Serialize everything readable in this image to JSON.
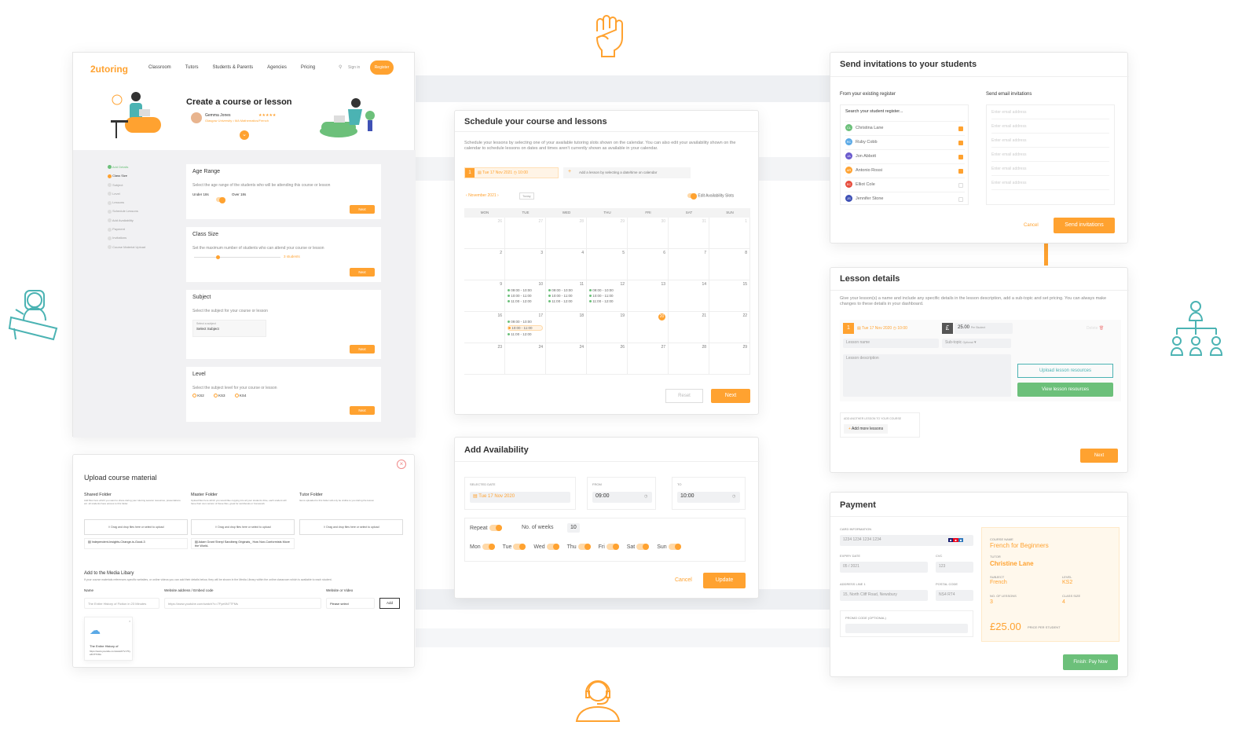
{
  "colors": {
    "accent": "#ffa230",
    "green": "#6cc07a",
    "teal": "#4bb3b3"
  },
  "brand": {
    "logo": "2utoring"
  },
  "nav": {
    "items": [
      "Classroom",
      "Tutors",
      "Students & Parents",
      "Agencies",
      "Pricing"
    ],
    "signin": "Sign in",
    "register": "Register"
  },
  "create": {
    "title": "Create a course or lesson",
    "tutor_name": "Gemma Jones",
    "tutor_sub": "Glasgow University • MA Mathematics/French",
    "steps": [
      "Add Details",
      "Class Size",
      "Subject",
      "Level",
      "Lessons",
      "Schedule Lessons",
      "Add Availability",
      "Payment",
      "Invitations",
      "Course Material Upload"
    ],
    "age": {
      "title": "Age Range",
      "desc": "Select the age range of the students who will be attending this course or lesson",
      "opt1": "Under 18s",
      "opt2": "Over 18s",
      "next": "Next"
    },
    "class": {
      "title": "Class Size",
      "desc": "Set the maximum number of students who can attend your course or lesson",
      "value": "3 students",
      "next": "Next"
    },
    "subject": {
      "title": "Subject",
      "desc": "Select the subject for your course or lesson",
      "select_label": "Select a subject",
      "select_value": "Select Subject",
      "next": "Next"
    },
    "level": {
      "title": "Level",
      "desc": "Select the subject level for your course or lesson",
      "opts": [
        "KS2",
        "KS3",
        "KS4"
      ],
      "next": "Next"
    }
  },
  "schedule": {
    "title": "Schedule your course and lessons",
    "desc": "Schedule your lessons by selecting one of your available tutoring slots shown on the calendar. You can also edit your availability shown on the calendar to schedule lessons on dates and times aren't currently shown as available in your calendar.",
    "lesson_num": "1",
    "lesson_date": "Tue 17 Nov 2021",
    "lesson_time": "10:00",
    "add_hint": "Add a lesson by selecting a date/time on calendar",
    "month": "November 2021",
    "today": "Today",
    "edit_avail": "Edit Availability Slots",
    "days": [
      "MON",
      "TUE",
      "WED",
      "THU",
      "FRI",
      "SAT",
      "SUN"
    ],
    "weeks": [
      [
        "26",
        "27",
        "28",
        "29",
        "30",
        "31",
        "1"
      ],
      [
        "2",
        "3",
        "4",
        "5",
        "6",
        "7",
        "8"
      ],
      [
        "9",
        "10",
        "11",
        "12",
        "13",
        "14",
        "15"
      ],
      [
        "16",
        "17",
        "18",
        "19",
        "20",
        "21",
        "22"
      ],
      [
        "23",
        "24",
        "24",
        "26",
        "27",
        "28",
        "29"
      ]
    ],
    "slots": [
      "09:00 - 10:00",
      "10:00 - 11:00",
      "11:00 - 12:00"
    ],
    "reset": "Reset",
    "next": "Next"
  },
  "availability": {
    "title": "Add Availability",
    "date_label": "SELECTED DATE",
    "date": "Tue 17 Nov 2020",
    "from_label": "FROM",
    "from": "09:00",
    "to_label": "TO",
    "to": "10:00",
    "repeat": "Repeat",
    "weeks_label": "No. of weeks",
    "weeks": "10",
    "days": [
      "Mon",
      "Tue",
      "Wed",
      "Thu",
      "Fri",
      "Sat",
      "Sun"
    ],
    "cancel": "Cancel",
    "update": "Update"
  },
  "upload": {
    "title": "Upload course material",
    "folders": [
      {
        "name": "Shared Folder",
        "desc": "Add files here which you want to share during your tutoring session resources, presentations etc. all students have access to this folder.",
        "drop": "Drag and drop files here or select to upload",
        "file": "Independent-Insights-Change-is-Good-3"
      },
      {
        "name": "Master Folder",
        "desc": "Upload files here which you would like copying into all your students drive, each student will have their own version of these files, great for workbooks or homework",
        "drop": "Drag and drop files here or select to upload",
        "file": "Adam Grant Sheryl Sandberg Originals_ How Non-Conformists Move the World-"
      },
      {
        "name": "Tutor Folder",
        "desc": "Items uploaded to this folder will only be visible to you during the lesson",
        "drop": "Drag and drop files here or select to upload",
        "file": ""
      }
    ],
    "media_title": "Add to the Media Libary",
    "media_desc": "If your course materials references specific websites, or online videos you can add their details below, they will be shown in the Media Library within the online classroom which is available to each student.",
    "name_label": "Name",
    "name_value": "The Entire History of Fiction in 23 Minutes",
    "url_label": "Website address / Embed code",
    "url_value": "https://www.youtube.com/watch?v=7Fye6N7TFMs",
    "type_label": "Website or Video",
    "type_value": "Please select",
    "add": "Add",
    "thumb_title": "The Entire History of",
    "thumb_url": "https://www.youtube.com/watch?v=7Fye6N7TFMs"
  },
  "invite": {
    "title": "Send invitations to your students",
    "from_title": "From your existing register",
    "email_title": "Send email invitations",
    "search": "Search your student register...",
    "students": [
      {
        "i": "CL",
        "n": "Christina Lane",
        "c": "#6cc07a",
        "on": true
      },
      {
        "i": "RC",
        "n": "Ruby Cobb",
        "c": "#5aa9e6",
        "on": true
      },
      {
        "i": "JA",
        "n": "Jon Abbott",
        "c": "#6a5acd",
        "on": true
      },
      {
        "i": "AR",
        "n": "Antonio Rossi",
        "c": "#ffa230",
        "on": true
      },
      {
        "i": "EC",
        "n": "Elliot Cole",
        "c": "#e74c3c",
        "on": false
      },
      {
        "i": "JS",
        "n": "Jennifer Stone",
        "c": "#3f51b5",
        "on": false
      }
    ],
    "email_ph": "Enter email address",
    "cancel": "Cancel",
    "send": "Send invitations"
  },
  "lesson": {
    "title": "Lesson details",
    "desc": "Give your lesson(s) a name and include any specific details in the lesson description, add a sub-topic and set pricing. You can always make changes to these details in your dashboard.",
    "num": "1",
    "date": "Tue 17 Nov 2020",
    "time": "10:00",
    "currency": "£",
    "price": "25.00",
    "per": "Per Student",
    "delete": "Delete",
    "name_ph": "Lesson name",
    "subtopic": "Sub-topic",
    "optional": "Optional",
    "desc_ph": "Lesson description",
    "upload": "Upload lesson resources",
    "view": "View lesson resources",
    "another": "ADD ANOTHER LESSON TO YOUR COURSE",
    "add_more": "Add more lessons",
    "next": "Next"
  },
  "payment": {
    "title": "Payment",
    "card_label": "CARD INFORMATION",
    "card": "1234 1234 1234 1234",
    "expiry_label": "EXPIRY DATE",
    "expiry": "05 / 2021",
    "cvc_label": "CVC",
    "cvc": "123",
    "addr_label": "ADDRESS LINE 1",
    "addr": "15, North Cliff Road, Newsbury",
    "post_label": "POSTAL CODE",
    "post": "NS4 RT4",
    "promo_label": "PROMO CODE (OPTIONAL)",
    "course_label": "COURSE NAME",
    "course": "French for Beginners",
    "tutor_label": "TUTOR",
    "tutor": "Christine Lane",
    "subject_label": "SUBJECT",
    "subject": "French",
    "level_label": "LEVEL",
    "level": "KS2",
    "lessons_label": "NO. OF LESSONS",
    "lessons": "3",
    "size_label": "CLASS SIZE",
    "size": "4",
    "price": "£25.00",
    "price_label": "PRICE PER STUDENT",
    "pay": "Finish: Pay Now"
  }
}
